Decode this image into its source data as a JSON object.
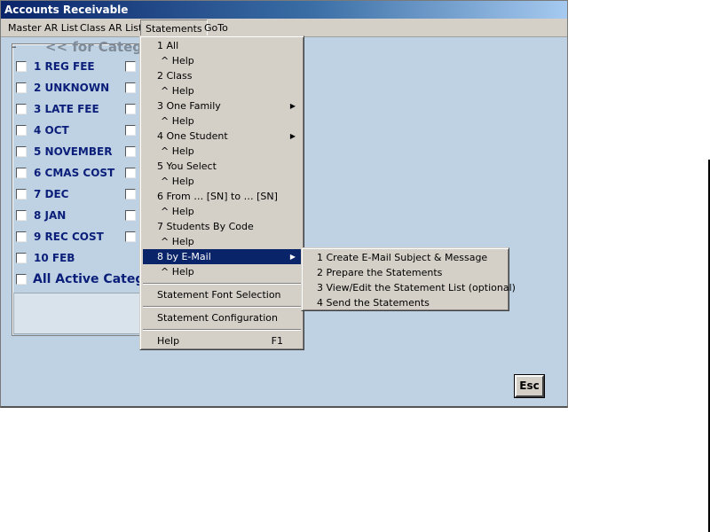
{
  "window": {
    "title": "Accounts Receivable"
  },
  "menubar": {
    "items": [
      {
        "label": "Master AR List"
      },
      {
        "label": "Class AR List"
      },
      {
        "label": "Statements"
      },
      {
        "label": "GoTo"
      }
    ]
  },
  "categories": {
    "header": "<<  for Categ",
    "items": [
      {
        "label": "1 REG FEE"
      },
      {
        "label": "2 UNKNOWN"
      },
      {
        "label": "3 LATE FEE"
      },
      {
        "label": "4 OCT"
      },
      {
        "label": "5 NOVEMBER"
      },
      {
        "label": "6 CMAS COST"
      },
      {
        "label": "7 DEC"
      },
      {
        "label": "8 JAN"
      },
      {
        "label": "9 REC COST"
      },
      {
        "label": "10 FEB"
      }
    ],
    "all_active": "All Active Categ"
  },
  "statements_menu": {
    "items": [
      {
        "label": "1 All"
      },
      {
        "label": "^ Help"
      },
      {
        "label": "2 Class"
      },
      {
        "label": "^ Help"
      },
      {
        "label": "3 One Family"
      },
      {
        "label": "^ Help"
      },
      {
        "label": "4 One Student"
      },
      {
        "label": "^ Help"
      },
      {
        "label": "5 You Select"
      },
      {
        "label": "^ Help"
      },
      {
        "label": "6 From … [SN] to … [SN]"
      },
      {
        "label": "^ Help"
      },
      {
        "label": "7 Students By Code"
      },
      {
        "label": "^ Help"
      },
      {
        "label": "8 by E-Mail"
      },
      {
        "label": "^ Help"
      }
    ],
    "font_selection": "Statement Font Selection",
    "configuration": "Statement Configuration",
    "help": "Help",
    "help_shortcut": "F1"
  },
  "email_submenu": {
    "items": [
      {
        "label": "1 Create E-Mail Subject & Message"
      },
      {
        "label": "2 Prepare the Statements"
      },
      {
        "label": "3 View/Edit the Statement List (optional)"
      },
      {
        "label": "4 Send the Statements"
      }
    ]
  },
  "esc_button": {
    "label": "Esc"
  }
}
